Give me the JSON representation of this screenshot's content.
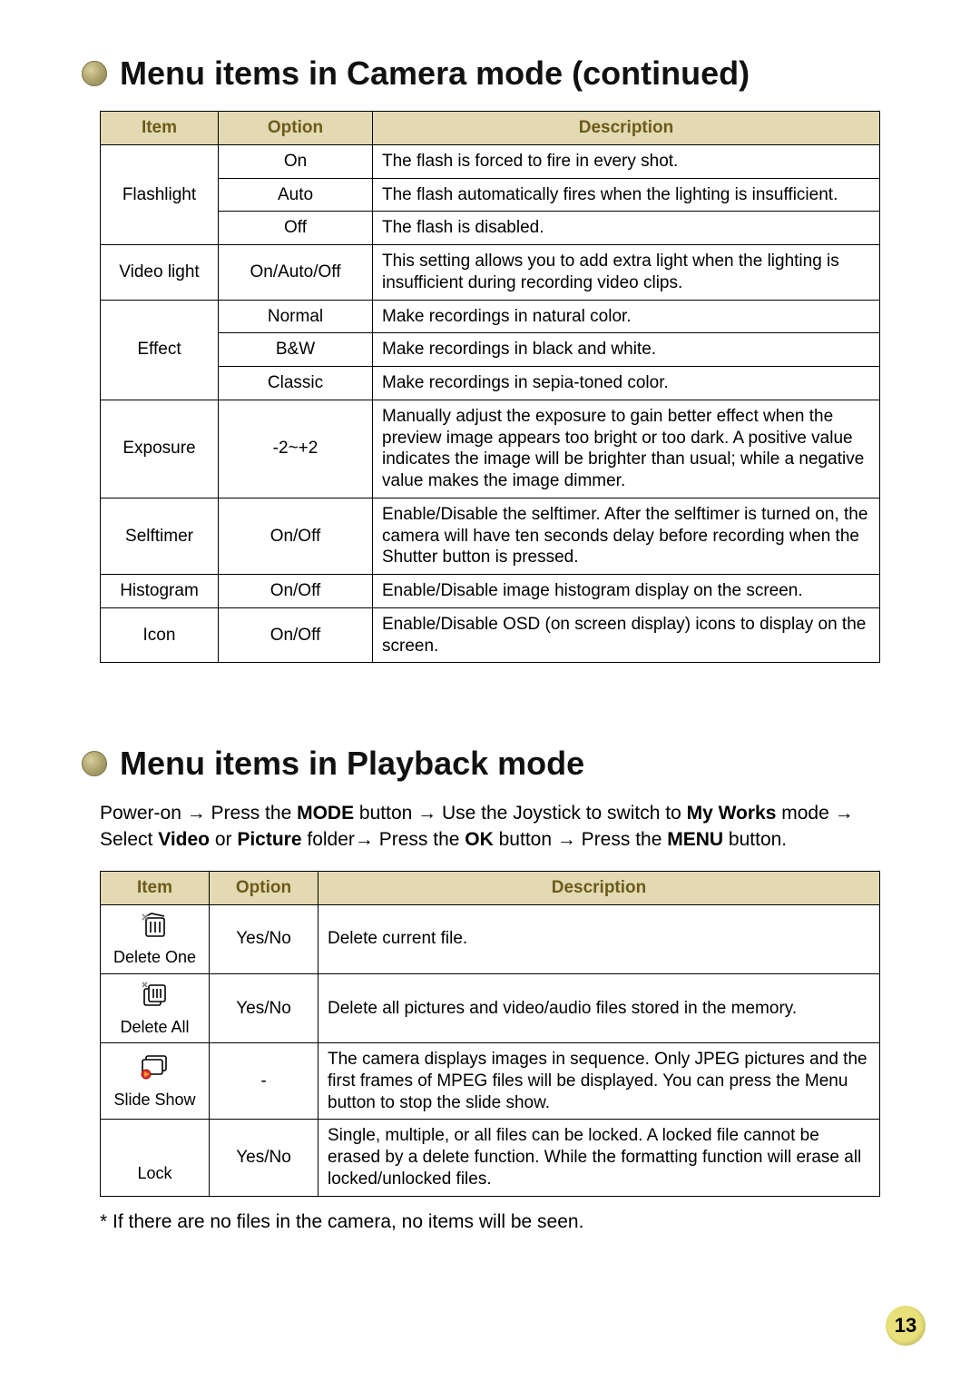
{
  "page_number": "13",
  "section1": {
    "title": "Menu items in Camera mode (continued)",
    "headers": {
      "item": "Item",
      "option": "Option",
      "desc": "Description"
    },
    "rows": [
      {
        "item": "Flashlight",
        "options": [
          {
            "opt": "On",
            "desc": "The flash is forced to fire in every shot."
          },
          {
            "opt": "Auto",
            "desc": "The flash automatically fires when the lighting is insufficient."
          },
          {
            "opt": "Off",
            "desc": "The flash is disabled."
          }
        ]
      },
      {
        "item": "Video light",
        "options": [
          {
            "opt": "On/Auto/Off",
            "desc": "This setting allows you to add extra light when the lighting is insufficient during recording video clips."
          }
        ]
      },
      {
        "item": "Effect",
        "options": [
          {
            "opt": "Normal",
            "desc": "Make recordings in natural color."
          },
          {
            "opt": "B&W",
            "desc": "Make recordings in black and white."
          },
          {
            "opt": "Classic",
            "desc": "Make recordings in sepia-toned color."
          }
        ]
      },
      {
        "item": "Exposure",
        "options": [
          {
            "opt": "-2~+2",
            "desc": "Manually adjust the exposure to gain better effect when the preview image appears too bright or too dark. A positive value indicates the image will be brighter than usual; while a negative value makes the image dimmer."
          }
        ]
      },
      {
        "item": "Selftimer",
        "options": [
          {
            "opt": "On/Off",
            "desc": "Enable/Disable the selftimer. After the selftimer is turned on, the camera will have ten seconds delay before recording when the Shutter button is pressed."
          }
        ]
      },
      {
        "item": "Histogram",
        "options": [
          {
            "opt": "On/Off",
            "desc": "Enable/Disable image histogram display on the screen."
          }
        ]
      },
      {
        "item": "Icon",
        "options": [
          {
            "opt": "On/Off",
            "desc": "Enable/Disable OSD (on screen display) icons to display on the screen."
          }
        ]
      }
    ]
  },
  "section2": {
    "title": "Menu items in Playback mode",
    "instruction_parts": [
      "Power-on → Press the ",
      "MODE",
      " button → Use the Joystick to switch to ",
      "My Works",
      " mode → Select ",
      "Video",
      " or ",
      "Picture",
      " folder→ Press the ",
      "OK",
      " button → Press the ",
      "MENU",
      " button."
    ],
    "instruction_bold_idx": [
      1,
      3,
      5,
      7,
      9,
      11
    ],
    "headers": {
      "item": "Item",
      "option": "Option",
      "desc": "Description"
    },
    "rows": [
      {
        "icon": "trash-one",
        "label": "Delete One",
        "opt": "Yes/No",
        "desc": "Delete current file."
      },
      {
        "icon": "trash-all",
        "label": "Delete All",
        "opt": "Yes/No",
        "desc": "Delete all pictures and video/audio files stored in the memory."
      },
      {
        "icon": "slideshow",
        "label": "Slide Show",
        "opt": "-",
        "desc": "The camera displays images in sequence. Only JPEG pictures and the first frames of MPEG files will be displayed. You can press the Menu button to stop the slide show."
      },
      {
        "icon": "lock-blank",
        "label": "Lock",
        "opt": "Yes/No",
        "desc": "Single, multiple, or all files can be locked. A locked file cannot be erased by a delete function. While the formatting function will erase all locked/unlocked files."
      }
    ],
    "footnote": "* If there are no files in the camera, no items will be seen."
  }
}
